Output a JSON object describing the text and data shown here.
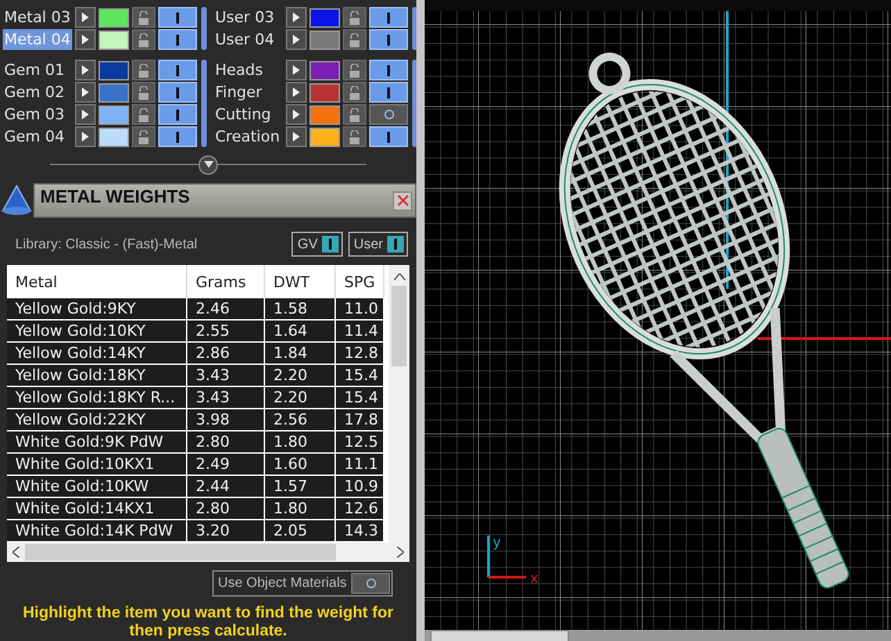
{
  "layer_blocks": [
    {
      "columns": [
        [
          {
            "name": "Metal 03",
            "color": "#5ee65e",
            "selected": false,
            "on": true
          },
          {
            "name": "Metal 04",
            "color": "#c4f5bd",
            "selected": true,
            "on": true
          }
        ],
        [
          {
            "name": "User 03",
            "color": "#0a14e6",
            "selected": false,
            "on": true
          },
          {
            "name": "User 04",
            "color": "#7a7a7a",
            "selected": false,
            "on": true
          }
        ]
      ]
    },
    {
      "columns": [
        [
          {
            "name": "Gem 01",
            "color": "#0a3a9e",
            "selected": false,
            "on": true
          },
          {
            "name": "Gem 02",
            "color": "#3a72c8",
            "selected": false,
            "on": true
          },
          {
            "name": "Gem 03",
            "color": "#7fb4f4",
            "selected": false,
            "on": true
          },
          {
            "name": "Gem 04",
            "color": "#bcdcfb",
            "selected": false,
            "on": true
          }
        ],
        [
          {
            "name": "Heads",
            "color": "#7a1fb4",
            "selected": false,
            "on": true
          },
          {
            "name": "Finger",
            "color": "#b83434",
            "selected": false,
            "on": true
          },
          {
            "name": "Cutting",
            "color": "#f57010",
            "selected": false,
            "on": false
          },
          {
            "name": "Creation",
            "color": "#fbb21e",
            "selected": false,
            "on": true
          }
        ]
      ]
    }
  ],
  "panel": {
    "title": "METAL WEIGHTS",
    "library": "Library: Classic - (Fast)-Metal",
    "toggles": [
      {
        "label": "GV",
        "on": true
      },
      {
        "label": "User",
        "on": true
      }
    ],
    "table": {
      "columns": [
        "Metal",
        "Grams",
        "DWT",
        "SPG"
      ],
      "rows": [
        [
          "Yellow Gold:9KY",
          "2.46",
          "1.58",
          "11.0"
        ],
        [
          "Yellow Gold:10KY",
          "2.55",
          "1.64",
          "11.4"
        ],
        [
          "Yellow Gold:14KY",
          "2.86",
          "1.84",
          "12.8"
        ],
        [
          "Yellow Gold:18KY",
          "3.43",
          "2.20",
          "15.4"
        ],
        [
          "Yellow Gold:18KY R...",
          "3.43",
          "2.20",
          "15.4"
        ],
        [
          "Yellow Gold:22KY",
          "3.98",
          "2.56",
          "17.8"
        ],
        [
          "White Gold:9K PdW",
          "2.80",
          "1.80",
          "12.5"
        ],
        [
          "White Gold:10KX1",
          "2.49",
          "1.60",
          "11.1"
        ],
        [
          "White Gold:10KW",
          "2.44",
          "1.57",
          "10.9"
        ],
        [
          "White Gold:14KX1",
          "2.80",
          "1.80",
          "12.6"
        ],
        [
          "White Gold:14K PdW",
          "3.20",
          "2.05",
          "14.3"
        ]
      ]
    },
    "use_object_materials": {
      "label": "Use Object Materials",
      "on": false
    },
    "hint": "Highlight the item you want to find the weight for then press calculate."
  },
  "viewport": {
    "axis_labels": [
      "y",
      "x"
    ]
  }
}
